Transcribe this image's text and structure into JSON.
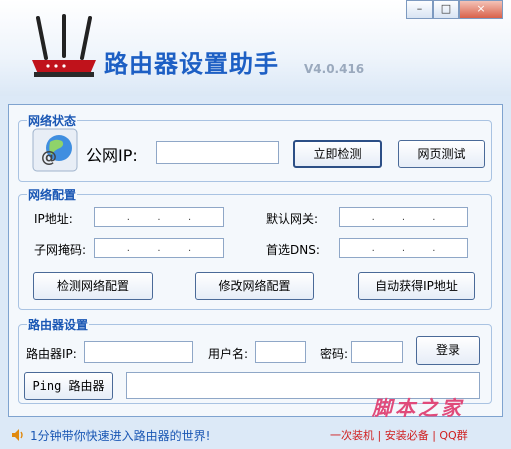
{
  "app": {
    "title": "路由器设置助手",
    "version": "V4.0.416"
  },
  "window_controls": {
    "minimize": "–",
    "maximize": "□",
    "close": "×"
  },
  "network_status": {
    "legend": "网络状态",
    "public_ip_label": "公网IP:",
    "public_ip_value": "",
    "detect_button": "立即检测",
    "webtest_button": "网页测试"
  },
  "network_config": {
    "legend": "网络配置",
    "ip_label": "IP地址:",
    "mask_label": "子网掩码:",
    "gateway_label": "默认网关:",
    "dns_label": "首选DNS:",
    "ip_placeholder": ".     .     .",
    "check_button": "检测网络配置",
    "modify_button": "修改网络配置",
    "auto_button": "自动获得IP地址"
  },
  "router_settings": {
    "legend": "路由器设置",
    "router_ip_label": "路由器IP:",
    "username_label": "用户名:",
    "password_label": "密码:",
    "login_button": "登录",
    "ping_button": "Ping 路由器"
  },
  "statusbar": {
    "message": "1分钟带你快速进入路由器的世界!",
    "footer_links": "一次装机 | 安装必备 | QQ群",
    "watermark": "脚本之家"
  }
}
